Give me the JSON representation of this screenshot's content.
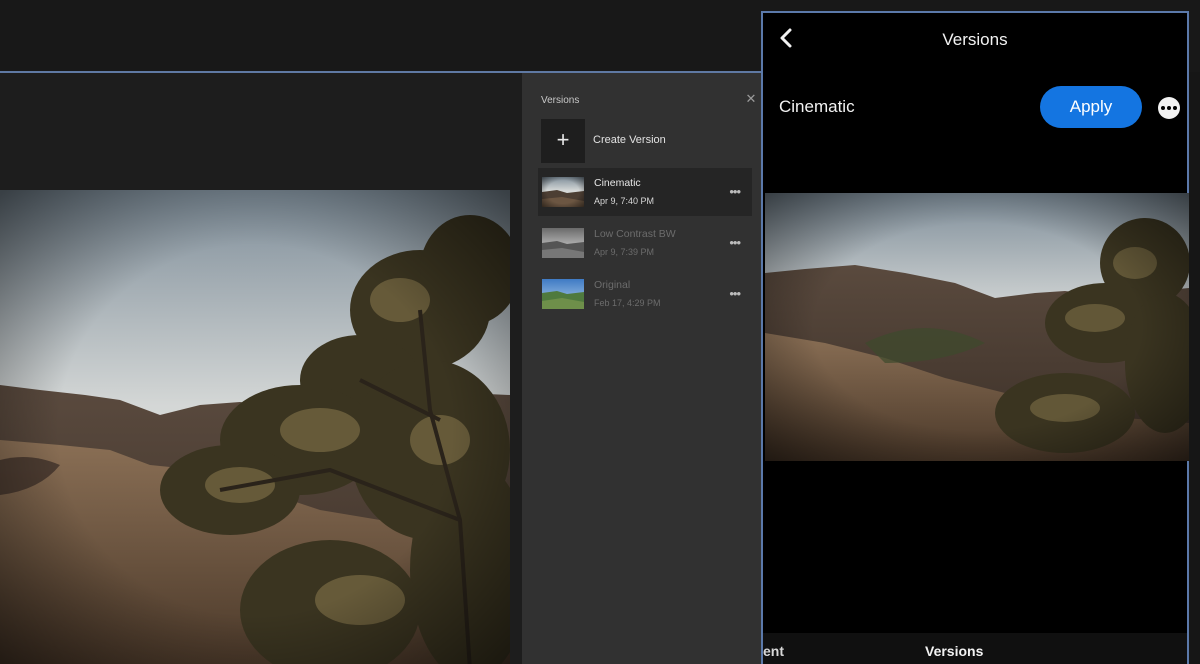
{
  "desktop": {
    "versions_panel": {
      "title": "Versions",
      "close_glyph": "✕",
      "create_icon": "+",
      "create_label": "Create Version",
      "items": [
        {
          "name": "Cinematic",
          "date": "Apr 9, 7:40 PM",
          "selected": true,
          "thumb": "cinematic"
        },
        {
          "name": "Low Contrast BW",
          "date": "Apr 9, 7:39 PM",
          "selected": false,
          "thumb": "bw"
        },
        {
          "name": "Original",
          "date": "Feb 17, 4:29 PM",
          "selected": false,
          "thumb": "original"
        }
      ],
      "more_glyph": "•••"
    }
  },
  "mobile": {
    "back_icon": "chevron-left-icon",
    "title": "Versions",
    "version_name": "Cinematic",
    "apply_label": "Apply",
    "more_icon": "more-circle-icon",
    "bottom_tabs": {
      "left_partial": "ent",
      "versions": "Versions"
    }
  },
  "colors": {
    "accent_blue": "#1475e1",
    "panel_bg": "#313131",
    "window_border": "#5b79aa"
  }
}
